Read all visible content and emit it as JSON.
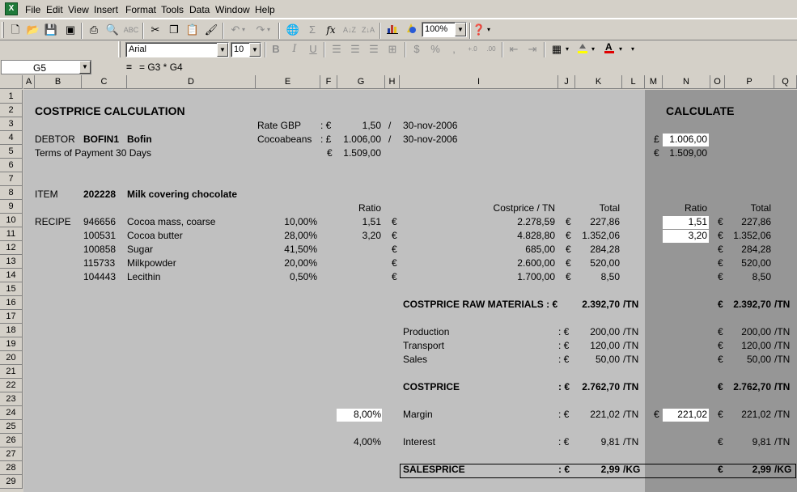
{
  "menu": [
    "File",
    "Edit",
    "View",
    "Insert",
    "Format",
    "Tools",
    "Data",
    "Window",
    "Help"
  ],
  "toolbar": {
    "zoom": "100%",
    "font": "Arial",
    "size": "10"
  },
  "formula_bar": {
    "cell_ref": "G5",
    "equals": "=",
    "formula": "= G3 * G4"
  },
  "columns": [
    "A",
    "B",
    "C",
    "D",
    "E",
    "F",
    "G",
    "H",
    "I",
    "J",
    "K",
    "L",
    "M",
    "N",
    "O",
    "P",
    "Q"
  ],
  "rows": [
    "1",
    "2",
    "3",
    "4",
    "5",
    "6",
    "7",
    "8",
    "9",
    "10",
    "11",
    "12",
    "13",
    "14",
    "15",
    "16",
    "17",
    "18",
    "19",
    "20",
    "21",
    "22",
    "23",
    "24",
    "25",
    "26",
    "27",
    "28",
    "29"
  ],
  "colors": {
    "sheet_bg": "#c0c0c0",
    "calc_bg": "#969696",
    "highlight": "#ffffff",
    "header_bg": "#d4d0c8"
  },
  "icons": [
    "app-excel-icon",
    "new-icon",
    "open-icon",
    "save-icon",
    "permission-icon",
    "print-icon",
    "print-preview-icon",
    "spelling-icon",
    "cut-icon",
    "copy-icon",
    "paste-icon",
    "format-painter-icon",
    "undo-icon",
    "redo-icon",
    "hyperlink-icon",
    "autosum-icon",
    "function-icon",
    "sort-ascending-icon",
    "sort-descending-icon",
    "chart-wizard-icon",
    "drawing-icon",
    "help-icon",
    "bold-icon",
    "italic-icon",
    "underline-icon",
    "align-left-icon",
    "center-icon",
    "align-right-icon",
    "merge-center-icon",
    "currency-icon",
    "percent-icon",
    "comma-icon",
    "increase-decimal-icon",
    "decrease-decimal-icon",
    "decrease-indent-icon",
    "increase-indent-icon",
    "borders-icon",
    "fill-color-icon",
    "font-color-icon",
    "toolbar-options-icon"
  ],
  "cells": {
    "title": "COSTPRICE CALCULATION",
    "calc_title": "CALCULATE",
    "rate_label": "Rate GBP",
    "rate_sep": ": €",
    "rate_val": "1,50",
    "rate_slash": "/",
    "rate_date": "30-nov-2006",
    "debtor_label": "DEBTOR",
    "debtor_code": "BOFIN1",
    "debtor_name": "Bofin",
    "cocoa_label": "Cocoabeans",
    "cocoa_sep": ": £",
    "cocoa_val": "1.006,00",
    "cocoa_slash": "/",
    "cocoa_date": "30-nov-2006",
    "n4_cur": "£",
    "n4_val": "1.006,00",
    "terms": "Terms of Payment 30 Days",
    "g5_cur": "€",
    "g5_val": "1.509,00",
    "n5_cur": "€",
    "n5_val": "1.509,00",
    "item_label": "ITEM",
    "item_code": "202228",
    "item_name": "Milk covering chocolate",
    "ratio_hdr": "Ratio",
    "costprice_hdr": "Costprice / TN",
    "total_hdr": "Total",
    "n_ratio_hdr": "Ratio",
    "p_total_hdr": "Total",
    "recipe_label": "RECIPE",
    "ingredients": [
      {
        "code": "946656",
        "name": "Cocoa mass, coarse",
        "pct": "10,00%",
        "ratio": "1,51",
        "h": "€",
        "cost": "2.278,59",
        "j": "€",
        "total": "227,86",
        "n": "1,51",
        "o": "€",
        "p": "227,86"
      },
      {
        "code": "100531",
        "name": "Cocoa butter",
        "pct": "28,00%",
        "ratio": "3,20",
        "h": "€",
        "cost": "4.828,80",
        "j": "€",
        "total": "1.352,06",
        "n": "3,20",
        "o": "€",
        "p": "1.352,06"
      },
      {
        "code": "100858",
        "name": "Sugar",
        "pct": "41,50%",
        "ratio": "",
        "h": "€",
        "cost": "685,00",
        "j": "€",
        "total": "284,28",
        "n": "",
        "o": "€",
        "p": "284,28"
      },
      {
        "code": "115733",
        "name": "Milkpowder",
        "pct": "20,00%",
        "ratio": "",
        "h": "€",
        "cost": "2.600,00",
        "j": "€",
        "total": "520,00",
        "n": "",
        "o": "€",
        "p": "520,00"
      },
      {
        "code": "104443",
        "name": "Lecithin",
        "pct": "0,50%",
        "ratio": "",
        "h": "€",
        "cost": "1.700,00",
        "j": "€",
        "total": "8,50",
        "n": "",
        "o": "€",
        "p": "8,50"
      }
    ],
    "raw_label": "COSTPRICE RAW MATERIALS : €",
    "raw_val": "2.392,70",
    "raw_unit": "/TN",
    "raw_p_cur": "€",
    "raw_p_val": "2.392,70",
    "raw_p_unit": "/TN",
    "production_label": "Production",
    "production_sep": ": €",
    "production_val": "200,00",
    "production_unit": "/TN",
    "production_p_cur": "€",
    "production_p_val": "200,00",
    "production_p_unit": "/TN",
    "transport_label": "Transport",
    "transport_sep": ": €",
    "transport_val": "120,00",
    "transport_unit": "/TN",
    "transport_p_cur": "€",
    "transport_p_val": "120,00",
    "transport_p_unit": "/TN",
    "sales_label": "Sales",
    "sales_sep": ": €",
    "sales_val": "50,00",
    "sales_unit": "/TN",
    "sales_p_cur": "€",
    "sales_p_val": "50,00",
    "sales_p_unit": "/TN",
    "cost_label": "COSTPRICE",
    "cost_sep": ": €",
    "cost_val": "2.762,70",
    "cost_unit": "/TN",
    "cost_p_cur": "€",
    "cost_p_val": "2.762,70",
    "cost_p_unit": "/TN",
    "margin_pct": "8,00%",
    "margin_label": "Margin",
    "margin_sep": ": €",
    "margin_val": "221,02",
    "margin_unit": "/TN",
    "margin_m_cur": "€",
    "margin_n_val": "221,02",
    "margin_p_cur": "€",
    "margin_p_val": "221,02",
    "margin_p_unit": "/TN",
    "interest_pct": "4,00%",
    "interest_label": "Interest",
    "interest_sep": ": €",
    "interest_val": "9,81",
    "interest_unit": "/TN",
    "interest_p_cur": "€",
    "interest_p_val": "9,81",
    "interest_p_unit": "/TN",
    "sp_label": "SALESPRICE",
    "sp_sep": ": €",
    "sp_val": "2,99",
    "sp_unit": "/KG",
    "sp_p_cur": "€",
    "sp_p_val": "2,99",
    "sp_p_unit": "/KG"
  }
}
